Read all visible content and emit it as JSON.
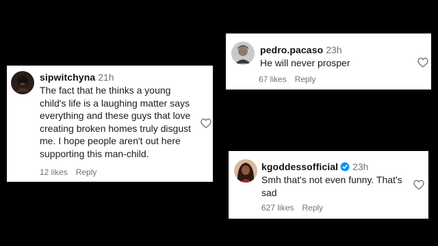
{
  "comments": [
    {
      "username": "sipwitchyna",
      "time": "21h",
      "verified": false,
      "text": "The fact that he thinks a young child's life is a laughing matter says everything and these guys that love creating broken homes truly disgust me. I hope people aren't out here supporting this man-child.",
      "likes": "12 likes",
      "reply_label": "Reply",
      "avatar_icon": "profile-photo"
    },
    {
      "username": "pedro.pacaso",
      "time": "23h",
      "verified": false,
      "text": "He will never prosper",
      "likes": "67 likes",
      "reply_label": "Reply",
      "avatar_icon": "profile-photo"
    },
    {
      "username": "kgoddessofficial",
      "time": "23h",
      "verified": true,
      "text": "Smh that's not even funny. That's sad",
      "likes": "627 likes",
      "reply_label": "Reply",
      "avatar_icon": "profile-photo"
    }
  ],
  "colors": {
    "background": "#000000",
    "card": "#ffffff",
    "muted_text": "#737373",
    "verified_badge": "#0095f6"
  },
  "icons": {
    "like": "heart-outline-icon",
    "verified": "verified-badge-icon"
  }
}
